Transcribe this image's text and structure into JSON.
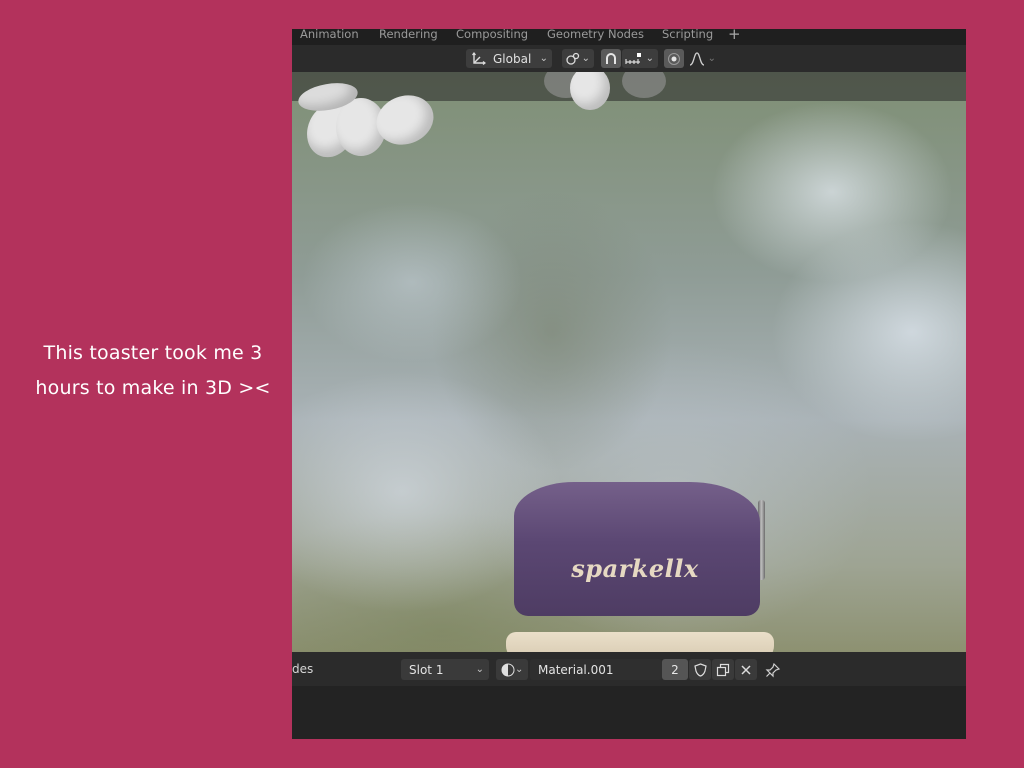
{
  "caption": {
    "line1": "This toaster took me 3",
    "line2": "hours to make in 3D ><"
  },
  "workspace_tabs": [
    "Animation",
    "Rendering",
    "Compositing",
    "Geometry Nodes",
    "Scripting"
  ],
  "workspace_add": "+",
  "toolbar": {
    "orientation": "Global"
  },
  "toaster": {
    "brand": "sparkellx"
  },
  "properties": {
    "partial_label": "des",
    "slot": "Slot 1",
    "material_name": "Material.001",
    "user_count": "2"
  },
  "icons": [
    "transform-orientation-icon",
    "pivot-icon",
    "snap-magnet-icon",
    "snap-increment-icon",
    "proportional-edit-icon",
    "falloff-curve-icon",
    "material-browse-icon",
    "fake-user-shield-icon",
    "duplicate-material-icon",
    "unlink-close-icon",
    "pin-icon"
  ]
}
